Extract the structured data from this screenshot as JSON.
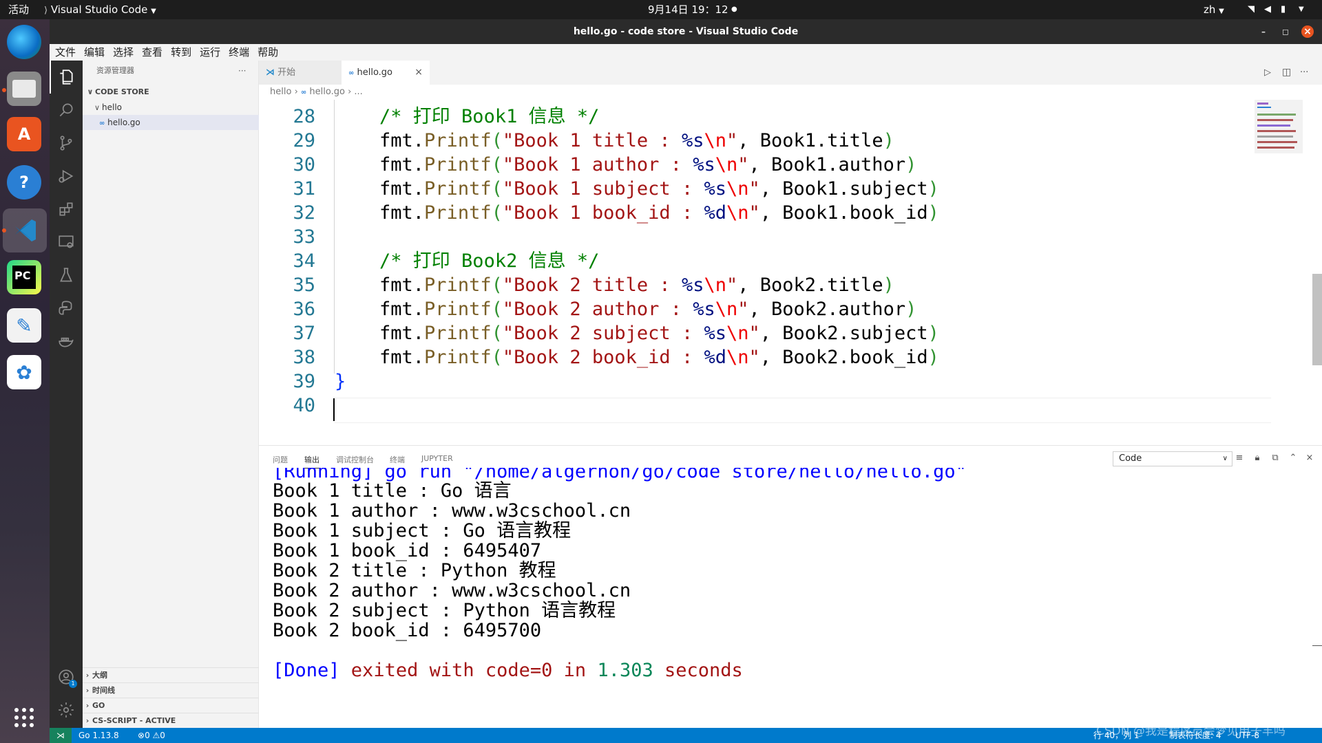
{
  "system": {
    "activities": "活动",
    "app_name": "Visual Studio Code",
    "clock": "9月14日  19：12",
    "input_method": "zh"
  },
  "window": {
    "title": "hello.go - code store - Visual Studio Code"
  },
  "menu": [
    "文件",
    "编辑",
    "选择",
    "查看",
    "转到",
    "运行",
    "终端",
    "帮助"
  ],
  "sidebar": {
    "header": "资源管理器",
    "more": "···",
    "root": "CODE STORE",
    "folder": "hello",
    "file": "hello.go",
    "file_icon": "∞",
    "sections": [
      "大纲",
      "时间线",
      "GO",
      "CS-SCRIPT - ACTIVE"
    ]
  },
  "tabs": [
    {
      "label": "开始",
      "active": false
    },
    {
      "label": "hello.go",
      "active": true,
      "icon": "∞"
    }
  ],
  "breadcrumb": [
    "hello",
    "hello.go",
    "..."
  ],
  "editor": {
    "lines": [
      {
        "n": "28",
        "tokens": [
          [
            "    ",
            "id"
          ],
          [
            "/* 打印 Book1 信息 */",
            "kw-cmt"
          ]
        ]
      },
      {
        "n": "29",
        "tokens": [
          [
            "    fmt.",
            "id"
          ],
          [
            "Printf",
            "fn"
          ],
          [
            "(",
            "paren"
          ],
          [
            "\"Book 1 title : ",
            "str"
          ],
          [
            "%s",
            "fmtv"
          ],
          [
            "\\n",
            "esc"
          ],
          [
            "\"",
            "str"
          ],
          [
            ", Book1.title",
            "id"
          ],
          [
            ")",
            "paren"
          ]
        ]
      },
      {
        "n": "30",
        "tokens": [
          [
            "    fmt.",
            "id"
          ],
          [
            "Printf",
            "fn"
          ],
          [
            "(",
            "paren"
          ],
          [
            "\"Book 1 author : ",
            "str"
          ],
          [
            "%s",
            "fmtv"
          ],
          [
            "\\n",
            "esc"
          ],
          [
            "\"",
            "str"
          ],
          [
            ", Book1.author",
            "id"
          ],
          [
            ")",
            "paren"
          ]
        ]
      },
      {
        "n": "31",
        "tokens": [
          [
            "    fmt.",
            "id"
          ],
          [
            "Printf",
            "fn"
          ],
          [
            "(",
            "paren"
          ],
          [
            "\"Book 1 subject : ",
            "str"
          ],
          [
            "%s",
            "fmtv"
          ],
          [
            "\\n",
            "esc"
          ],
          [
            "\"",
            "str"
          ],
          [
            ", Book1.subject",
            "id"
          ],
          [
            ")",
            "paren"
          ]
        ]
      },
      {
        "n": "32",
        "tokens": [
          [
            "    fmt.",
            "id"
          ],
          [
            "Printf",
            "fn"
          ],
          [
            "(",
            "paren"
          ],
          [
            "\"Book 1 book_id : ",
            "str"
          ],
          [
            "%d",
            "fmtv"
          ],
          [
            "\\n",
            "esc"
          ],
          [
            "\"",
            "str"
          ],
          [
            ", Book1.book_id",
            "id"
          ],
          [
            ")",
            "paren"
          ]
        ]
      },
      {
        "n": "33",
        "tokens": []
      },
      {
        "n": "34",
        "tokens": [
          [
            "    ",
            "id"
          ],
          [
            "/* 打印 Book2 信息 */",
            "kw-cmt"
          ]
        ]
      },
      {
        "n": "35",
        "tokens": [
          [
            "    fmt.",
            "id"
          ],
          [
            "Printf",
            "fn"
          ],
          [
            "(",
            "paren"
          ],
          [
            "\"Book 2 title : ",
            "str"
          ],
          [
            "%s",
            "fmtv"
          ],
          [
            "\\n",
            "esc"
          ],
          [
            "\"",
            "str"
          ],
          [
            ", Book2.title",
            "id"
          ],
          [
            ")",
            "paren"
          ]
        ]
      },
      {
        "n": "36",
        "tokens": [
          [
            "    fmt.",
            "id"
          ],
          [
            "Printf",
            "fn"
          ],
          [
            "(",
            "paren"
          ],
          [
            "\"Book 2 author : ",
            "str"
          ],
          [
            "%s",
            "fmtv"
          ],
          [
            "\\n",
            "esc"
          ],
          [
            "\"",
            "str"
          ],
          [
            ", Book2.author",
            "id"
          ],
          [
            ")",
            "paren"
          ]
        ]
      },
      {
        "n": "37",
        "tokens": [
          [
            "    fmt.",
            "id"
          ],
          [
            "Printf",
            "fn"
          ],
          [
            "(",
            "paren"
          ],
          [
            "\"Book 2 subject : ",
            "str"
          ],
          [
            "%s",
            "fmtv"
          ],
          [
            "\\n",
            "esc"
          ],
          [
            "\"",
            "str"
          ],
          [
            ", Book2.subject",
            "id"
          ],
          [
            ")",
            "paren"
          ]
        ]
      },
      {
        "n": "38",
        "tokens": [
          [
            "    fmt.",
            "id"
          ],
          [
            "Printf",
            "fn"
          ],
          [
            "(",
            "paren"
          ],
          [
            "\"Book 2 book_id : ",
            "str"
          ],
          [
            "%d",
            "fmtv"
          ],
          [
            "\\n",
            "esc"
          ],
          [
            "\"",
            "str"
          ],
          [
            ", Book2.book_id",
            "id"
          ],
          [
            ")",
            "paren"
          ]
        ]
      },
      {
        "n": "39",
        "tokens": [
          [
            "}",
            "brace"
          ]
        ]
      },
      {
        "n": "40",
        "tokens": []
      }
    ]
  },
  "panel": {
    "tabs": [
      "问题",
      "输出",
      "调试控制台",
      "终端",
      "JUPYTER"
    ],
    "active_tab": "输出",
    "output_channel": "Code",
    "running_line": "[Running] go run \"/home/algernon/go/code store/hello/hello.go\"",
    "output_lines": [
      "Book 1 title : Go 语言",
      "Book 1 author : www.w3cschool.cn",
      "Book 1 subject : Go 语言教程",
      "Book 1 book_id : 6495407",
      "Book 2 title : Python 教程",
      "Book 2 author : www.w3cschool.cn",
      "Book 2 subject : Python 语言教程",
      "Book 2 book_id : 6495700"
    ],
    "done": {
      "bracket": "[Done]",
      "text1": " exited with ",
      "code": "code=0",
      "text2": " in ",
      "secs": "1.303",
      "text3": " seconds"
    }
  },
  "statusbar": {
    "go_version": "Go 1.13.8",
    "errors": "0",
    "warnings": "0",
    "position": "行 40，列 1",
    "tab_size": "制表符长度: 4",
    "encoding": "UTF-8",
    "watermark": "CSDN @我是程序员会梦见电子羊吗"
  },
  "colors": {
    "accent": "#007acc",
    "ubuntu_orange": "#e95420",
    "statusbar_remote": "#16825d"
  }
}
